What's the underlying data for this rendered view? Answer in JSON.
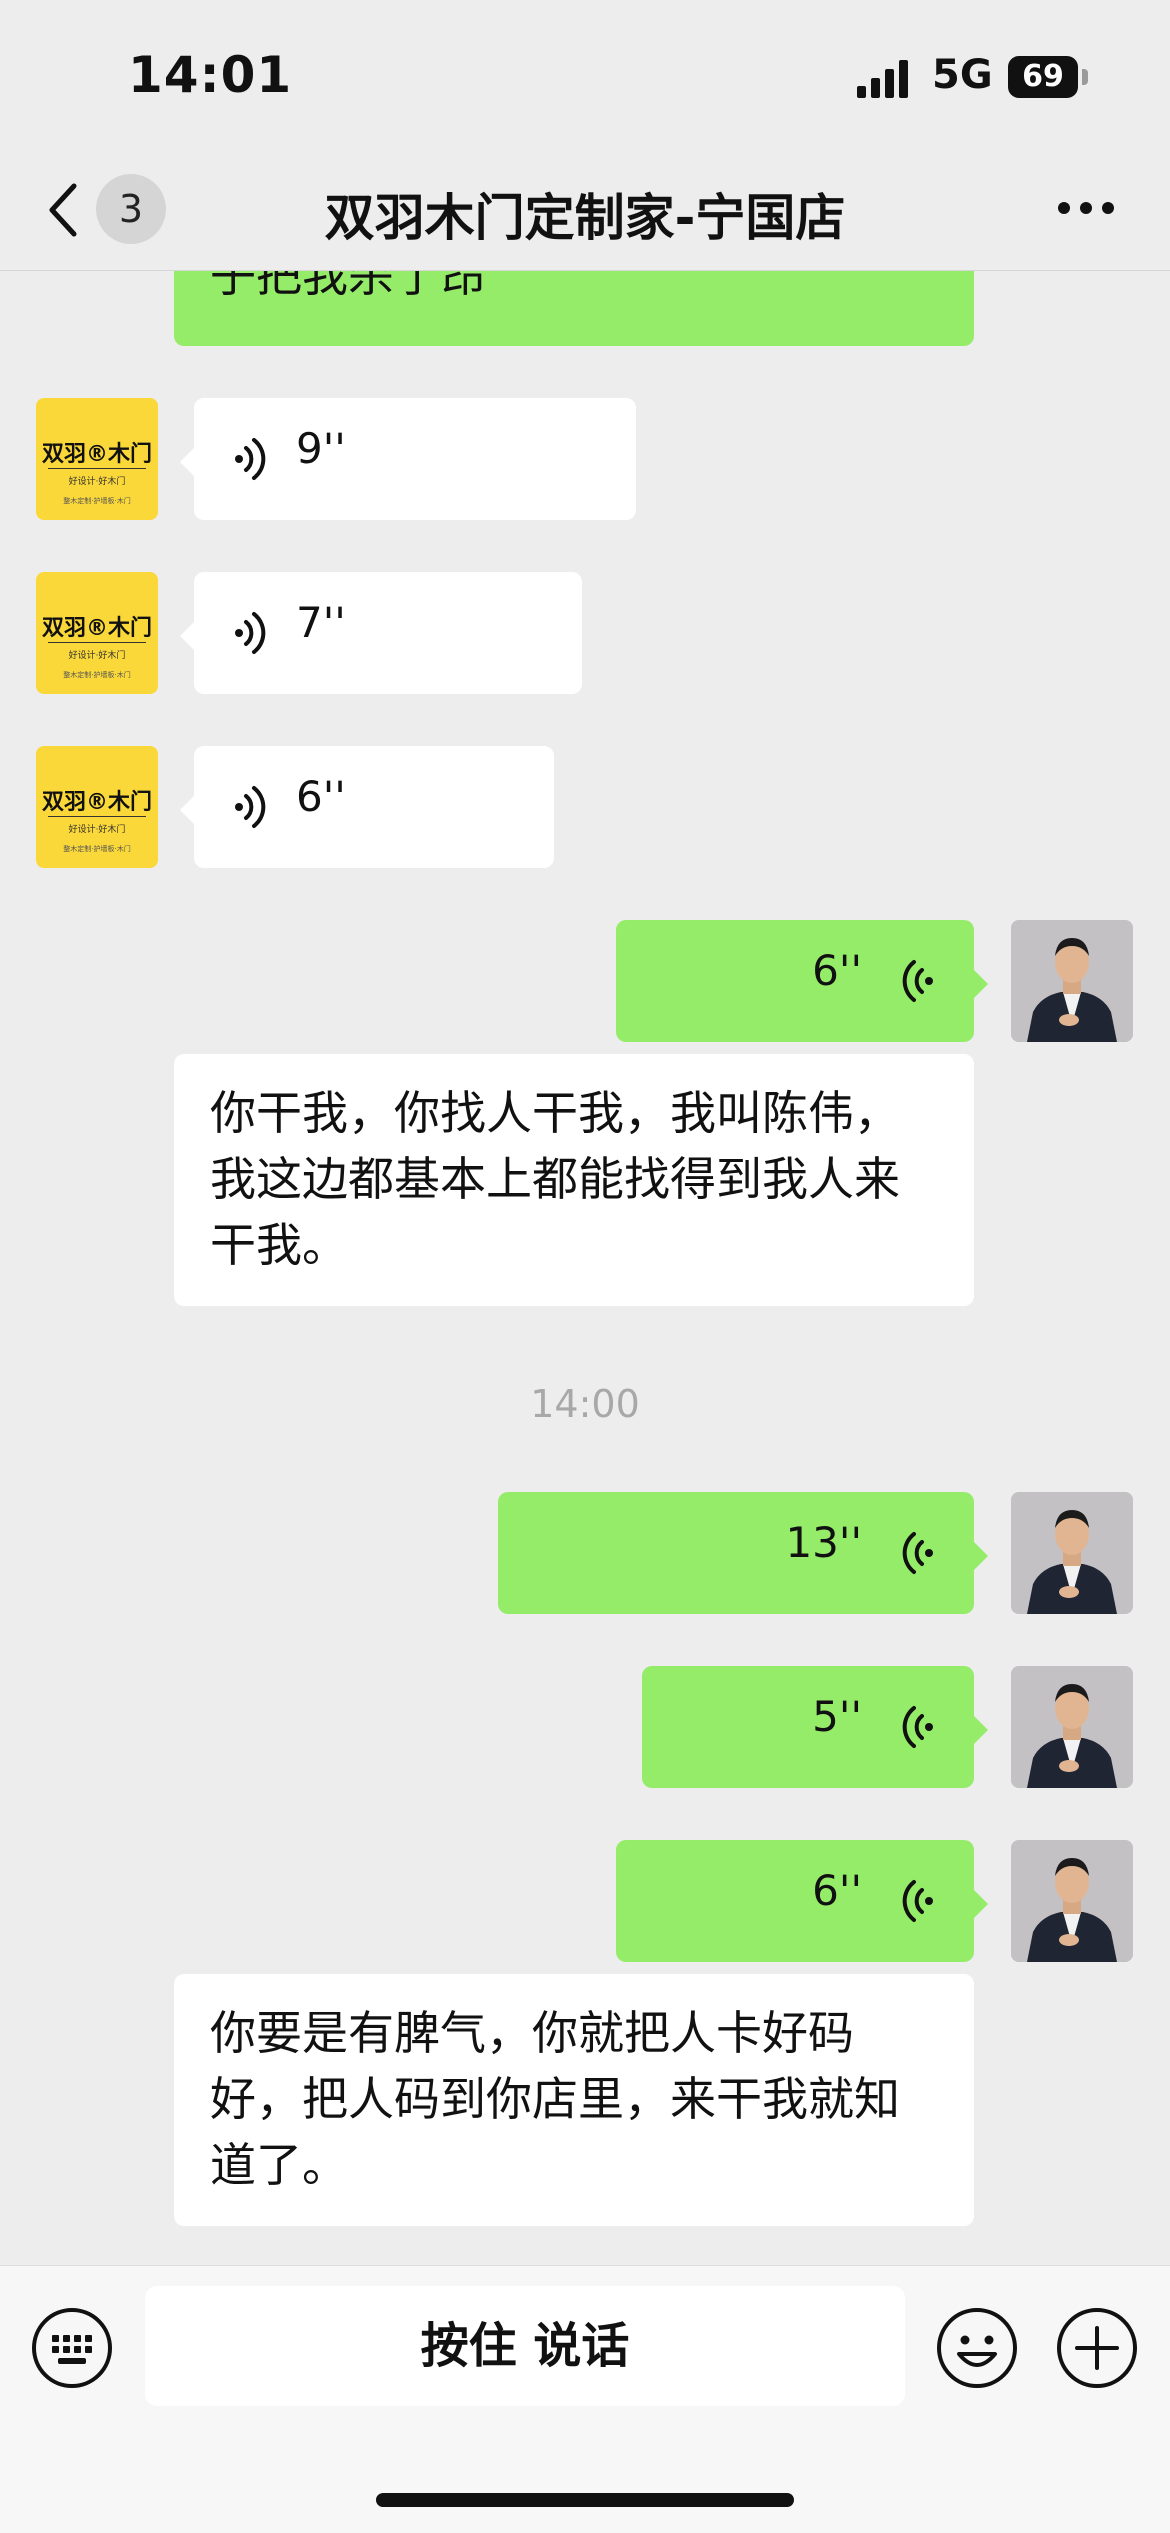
{
  "status": {
    "time": "14:01",
    "network": "5G",
    "battery": "69"
  },
  "nav": {
    "back_count": "3",
    "title": "双羽木门定制家-宁国店"
  },
  "timestamp": "14:00",
  "brand_avatar": {
    "logo": "双羽®木门",
    "tag": "好设计·好木门",
    "sub": "整木定制·护墙板·木门"
  },
  "messages": [
    {
      "kind": "text",
      "side": "right",
      "text": "子把我杀了昂"
    },
    {
      "kind": "voice",
      "side": "left",
      "duration": "9''"
    },
    {
      "kind": "voice",
      "side": "left",
      "duration": "7''"
    },
    {
      "kind": "voice",
      "side": "left",
      "duration": "6''"
    },
    {
      "kind": "voice",
      "side": "right",
      "duration": "6''"
    },
    {
      "kind": "transcript",
      "text": "你干我，你找人干我，我叫陈伟，我这边都基本上都能找得到我人来干我。"
    },
    {
      "kind": "voice",
      "side": "right",
      "duration": "13''"
    },
    {
      "kind": "voice",
      "side": "right",
      "duration": "5''"
    },
    {
      "kind": "voice",
      "side": "right",
      "duration": "6''"
    },
    {
      "kind": "transcript",
      "text": "你要是有脾气，你就把人卡好码好，把人码到你店里，来干我就知道了。"
    }
  ],
  "input": {
    "hold_to_talk": "按住 说话"
  }
}
